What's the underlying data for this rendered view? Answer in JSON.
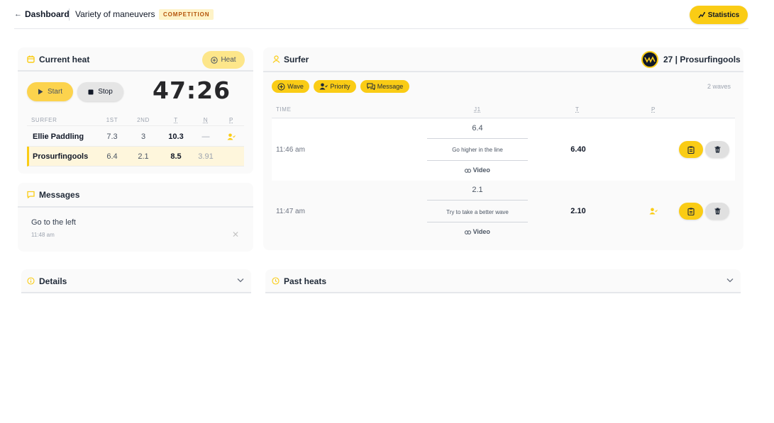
{
  "topbar": {
    "back_label": "Dashboard",
    "back_arrow": "←",
    "event_title": "Variety of maneuvers",
    "badge": "COMPETITION",
    "stats_label": "Statistics"
  },
  "heat": {
    "title": "Current heat",
    "heat_button": "Heat",
    "start_label": "Start",
    "stop_label": "Stop",
    "timer": "47:26",
    "columns": [
      "SURFER",
      "1ST",
      "2ND",
      "T",
      "N",
      "P"
    ],
    "rows": [
      {
        "surfer": "Ellie Paddling",
        "first": "7.3",
        "second": "3",
        "total": "10.3",
        "needs": "—",
        "priority": true,
        "selected": false
      },
      {
        "surfer": "Prosurfingools",
        "first": "6.4",
        "second": "2.1",
        "total": "8.5",
        "needs": "3.91",
        "priority": false,
        "selected": true
      }
    ]
  },
  "messages": {
    "title": "Messages",
    "items": [
      {
        "text": "Go to the left",
        "time": "11:48 am"
      }
    ]
  },
  "surfer": {
    "title": "Surfer",
    "id_label": "27 | Prosurfingools",
    "chips": {
      "wave": "Wave",
      "priority": "Priority",
      "message": "Message"
    },
    "waves_count": "2 waves",
    "columns": {
      "time": "TIME",
      "judge": "J1",
      "total": "T",
      "priority": "P"
    },
    "waves": [
      {
        "time": "11:46 am",
        "score": "6.4",
        "comment": "Go higher in the line",
        "video": "Video",
        "total": "6.40",
        "priority": false
      },
      {
        "time": "11:47 am",
        "score": "2.1",
        "comment": "Try to take a better wave",
        "video": "Video",
        "total": "2.10",
        "priority": true
      }
    ]
  },
  "details": {
    "title": "Details"
  },
  "past_heats": {
    "title": "Past heats"
  },
  "colors": {
    "accent": "#facc15",
    "accent_light": "#fde68a",
    "selected_row": "#fef6dc"
  }
}
